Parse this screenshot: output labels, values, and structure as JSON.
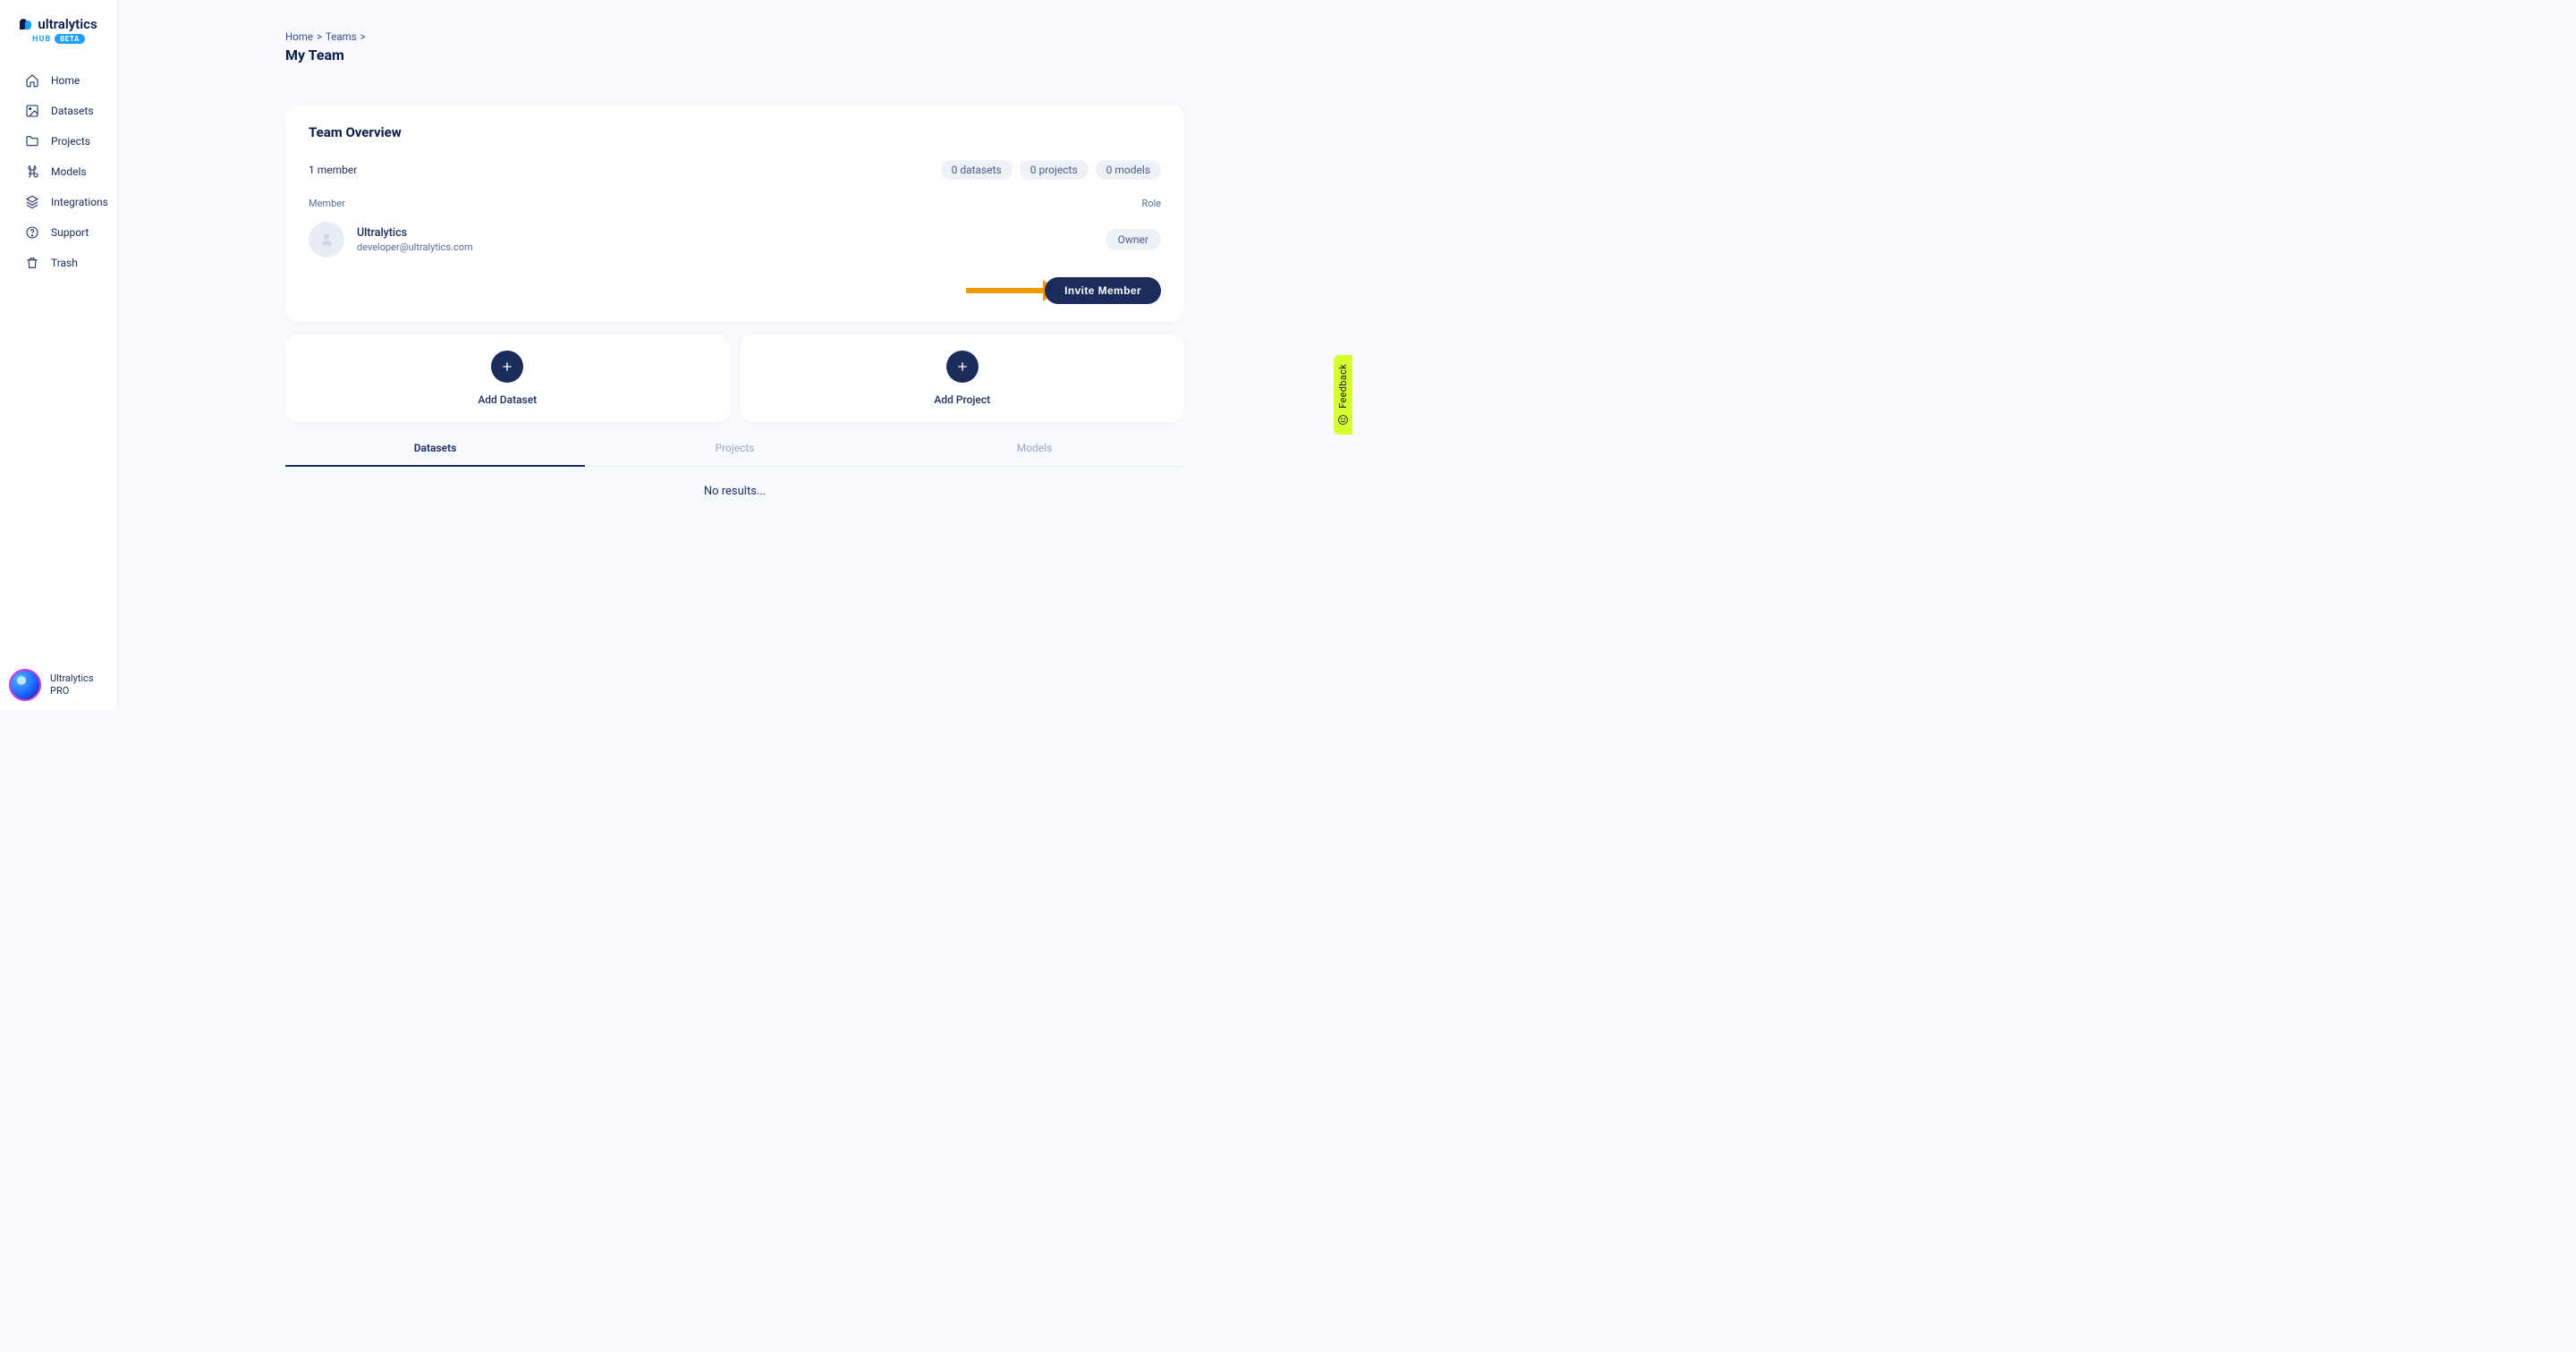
{
  "brand": {
    "name": "ultralytics",
    "hub": "HUB",
    "beta": "BETA"
  },
  "sidebar": {
    "items": [
      {
        "label": "Home"
      },
      {
        "label": "Datasets"
      },
      {
        "label": "Projects"
      },
      {
        "label": "Models"
      },
      {
        "label": "Integrations"
      },
      {
        "label": "Support"
      },
      {
        "label": "Trash"
      }
    ],
    "footer": {
      "name": "Ultralytics",
      "plan": "PRO"
    }
  },
  "breadcrumb": {
    "home": "Home",
    "teams": "Teams",
    "sep": ">"
  },
  "page": {
    "title": "My Team"
  },
  "overview": {
    "title": "Team Overview",
    "member_count": "1 member",
    "stats": {
      "datasets": "0 datasets",
      "projects": "0 projects",
      "models": "0 models"
    },
    "columns": {
      "member": "Member",
      "role": "Role"
    },
    "members": [
      {
        "name": "Ultralytics",
        "email": "developer@ultralytics.com",
        "role": "Owner"
      }
    ],
    "invite_label": "Invite Member"
  },
  "add_cards": {
    "dataset": "Add Dataset",
    "project": "Add Project"
  },
  "tabs": {
    "datasets": "Datasets",
    "projects": "Projects",
    "models": "Models"
  },
  "results": {
    "empty": "No results..."
  },
  "feedback": {
    "label": "Feedback"
  }
}
